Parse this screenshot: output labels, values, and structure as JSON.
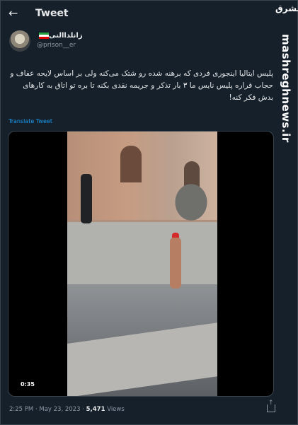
{
  "header": {
    "title": "Tweet"
  },
  "author": {
    "name": "زانلداالنی",
    "handle": "@prison__er"
  },
  "tweet": {
    "text": "پلیس ایتالیا اینجوری فردی که برهنه شده رو شتک می‌کنه ولی بر اساس لایحه عفاف و حجاب قراره پلیس نایس ما ۳ بار تذکر و جریمه نقدی بکنه تا بره تو اتاق به کارهای بدش فکر کنه!",
    "translate_label": "Translate Tweet",
    "video_time": "0:35",
    "timestamp": "2:25 PM · May 23, 2023",
    "views_count": "5,471",
    "views_label": "Views"
  },
  "watermark": {
    "logo": "مشرق",
    "site": "mashreghnews.ir"
  },
  "icons": [
    "back-arrow-icon",
    "share-icon"
  ]
}
